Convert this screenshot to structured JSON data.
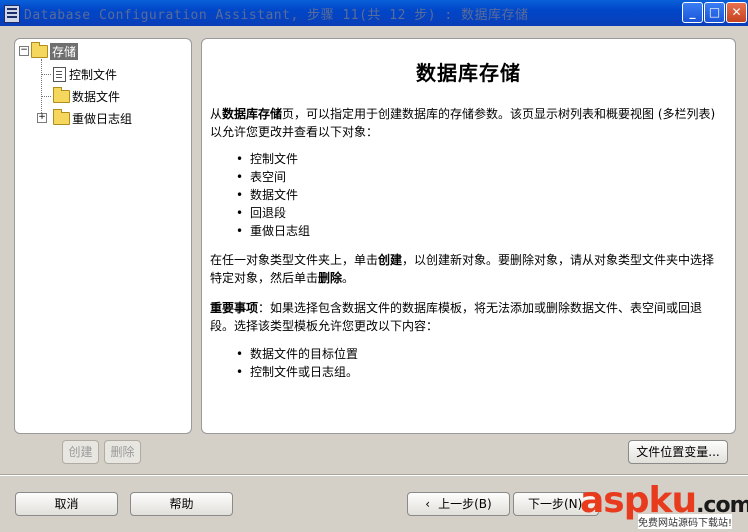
{
  "window": {
    "title": "Database Configuration Assistant, 步骤 11(共 12 步) : 数据库存储",
    "minimize_glyph": "_",
    "maximize_glyph": "□",
    "close_glyph": "✕"
  },
  "tree": {
    "root": {
      "label": "存储",
      "expander": "−"
    },
    "children": [
      {
        "label": "控制文件"
      },
      {
        "label": "数据文件"
      },
      {
        "label": "重做日志组",
        "expander": "+"
      }
    ]
  },
  "content": {
    "heading": "数据库存储",
    "intro_prefix": "从",
    "intro_bold": "数据库存储",
    "intro_rest": "页，可以指定用于创建数据库的存储参数。该页显示树列表和概要视图 (多栏列表)",
    "intro_line2": "以允许您更改并查看以下对象：",
    "objects": [
      "控制文件",
      "表空间",
      "数据文件",
      "回退段",
      "重做日志组"
    ],
    "create_text_1": "在任一对象类型文件夹上，单击",
    "create_bold": "创建",
    "create_text_2": "，以创建新对象。要删除对象，请从对象类型文件夹中选择",
    "create_text_3": "特定对象，然后单击",
    "delete_bold": "删除",
    "create_text_4": "。",
    "important_label": "重要事项",
    "important_text_1": "：如果选择包含数据文件的数据库模板，将无法添加或删除数据文件、表空间或回退",
    "important_text_2": "段。选择该类型模板允许您更改以下内容：",
    "allowed": [
      "数据文件的目标位置",
      "控制文件或日志组。"
    ]
  },
  "buttons": {
    "create": "创建",
    "delete": "删除",
    "file_location_vars": "文件位置变量...",
    "cancel": "取消",
    "help": "帮助",
    "back": "上一步(B)",
    "next": "下一步(N)"
  },
  "watermark": {
    "part1": "asp",
    "part2": "ku",
    "part3": ".com",
    "sub": "免费网站源码下载站!"
  }
}
